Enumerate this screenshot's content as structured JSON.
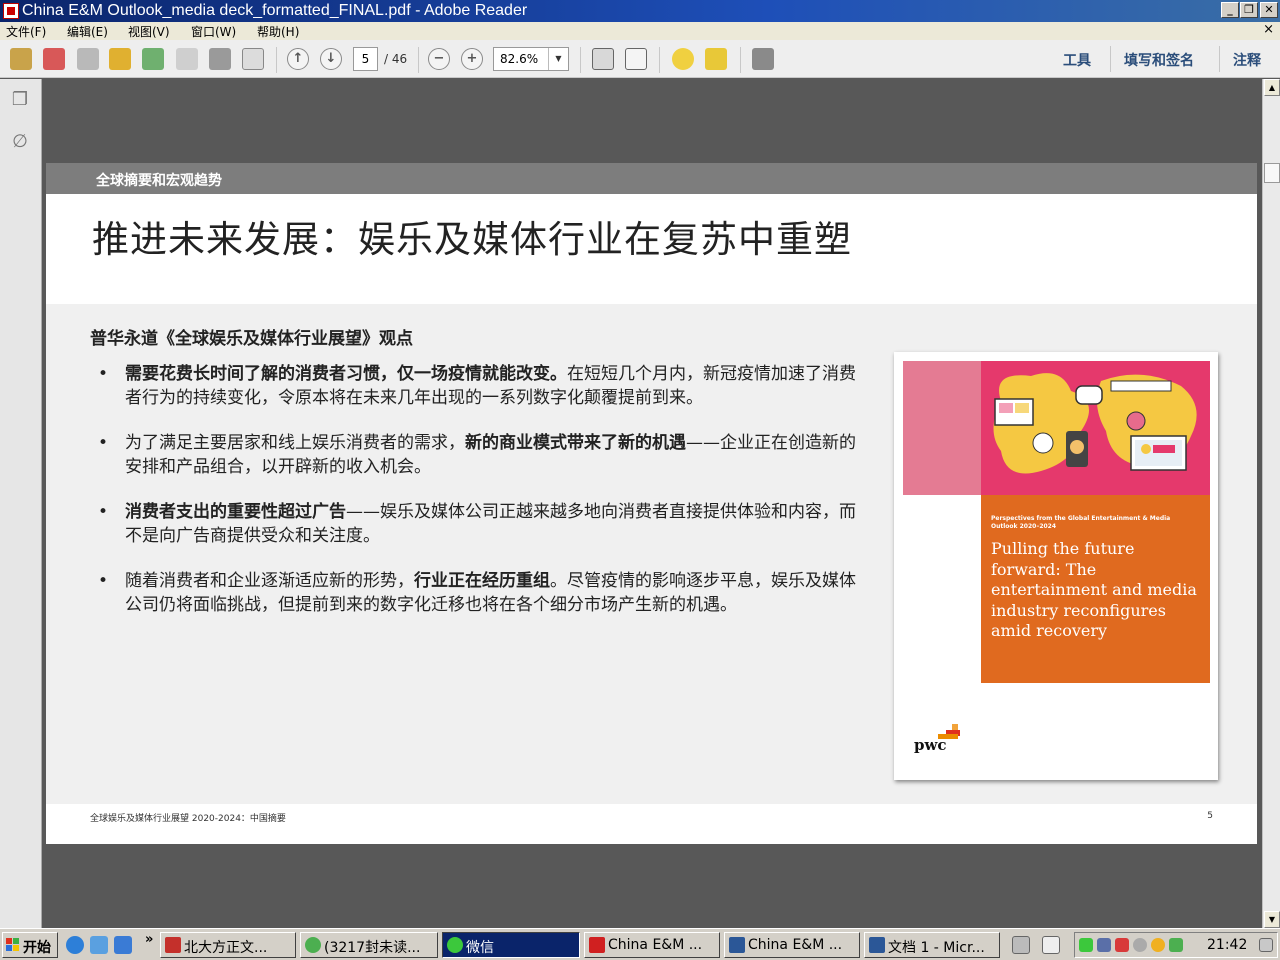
{
  "window": {
    "title": "China E&M Outlook_media deck_formatted_FINAL.pdf - Adobe Reader",
    "minimize": "_",
    "restore": "❐",
    "close": "✕"
  },
  "menu": {
    "items": [
      "文件(F)",
      "编辑(E)",
      "视图(V)",
      "窗口(W)",
      "帮助(H)"
    ],
    "close_glyph": "×"
  },
  "toolbar": {
    "current_page": "5",
    "page_total": "/ 46",
    "zoom": "82.6%",
    "zoom_out": "−",
    "zoom_in": "+",
    "links": [
      "工具",
      "填写和签名",
      "注释"
    ]
  },
  "page": {
    "section_label": "全球摘要和宏观趋势",
    "title": "推进未来发展：娱乐及媒体行业在复苏中重塑",
    "sub_heading": "普华永道《全球娱乐及媒体行业展望》观点",
    "bullets": [
      {
        "bold": "需要花费长时间了解的消费者习惯，仅一场疫情就能改变。",
        "text": "在短短几个月内，新冠疫情加速了消费者行为的持续变化，令原本将在未来几年出现的一系列数字化颠覆提前到来。",
        "bold_after": "",
        "text_after": ""
      },
      {
        "bold": "",
        "text": "为了满足主要居家和线上娱乐消费者的需求，",
        "bold_after": "新的商业模式带来了新的机遇",
        "text_after": "——企业正在创造新的安排和产品组合，以开辟新的收入机会。"
      },
      {
        "bold": "消费者支出的重要性超过广告",
        "text": "——娱乐及媒体公司正越来越多地向消费者直接提供体验和内容，而不是向广告商提供受众和关注度。",
        "bold_after": "",
        "text_after": ""
      },
      {
        "bold": "",
        "text": "随着消费者和企业逐渐适应新的形势，",
        "bold_after": "行业正在经历重组",
        "text_after": "。尽管疫情的影响逐步平息，娱乐及媒体公司仍将面临挑战，但提前到来的数字化迁移也将在各个细分市场产生新的机遇。"
      }
    ],
    "bullet_glyph": "•",
    "cover": {
      "kicker": "Perspectives from the Global Entertainment & Media Outlook 2020–2024",
      "title": "Pulling the future forward: The entertainment and media industry reconfigures amid recovery",
      "logo": "pwc"
    },
    "footer": "全球娱乐及媒体行业展望 2020-2024：中国摘要",
    "page_number": "5"
  },
  "taskbar": {
    "start": "开始",
    "quick_launch_more": "»",
    "tasks": [
      {
        "label": "北大方正文...",
        "active": false
      },
      {
        "label": "(3217封未读...",
        "active": false
      },
      {
        "label": "微信",
        "active": true
      },
      {
        "label": "China E&M ...",
        "active": false
      },
      {
        "label": "China E&M ...",
        "active": false
      },
      {
        "label": "文档 1 - Micr...",
        "active": false
      }
    ],
    "clock": "21:42"
  },
  "colors": {
    "cover_pink": "#e5396c",
    "cover_orange": "#e06a1f",
    "header_band": "#7d7d7d",
    "active_task": "#0a246a"
  }
}
